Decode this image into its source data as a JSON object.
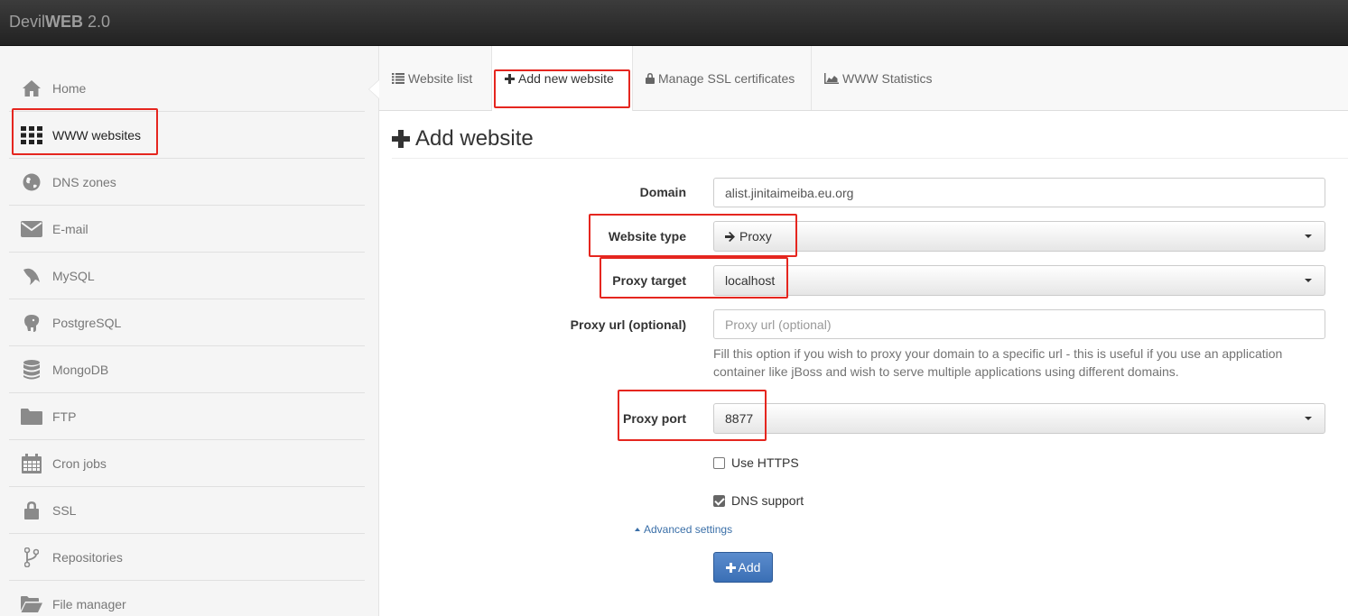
{
  "app": {
    "brand_light": "Devil",
    "brand_bold": "WEB",
    "brand_version": " 2.0"
  },
  "sidebar": {
    "items": [
      {
        "label": "Home",
        "icon": "home-icon"
      },
      {
        "label": "WWW websites",
        "icon": "grid-icon",
        "active": true
      },
      {
        "label": "DNS zones",
        "icon": "globe-icon"
      },
      {
        "label": "E-mail",
        "icon": "envelope-icon"
      },
      {
        "label": "MySQL",
        "icon": "dolphin-icon"
      },
      {
        "label": "PostgreSQL",
        "icon": "elephant-icon"
      },
      {
        "label": "MongoDB",
        "icon": "database-icon"
      },
      {
        "label": "FTP",
        "icon": "folder-icon"
      },
      {
        "label": "Cron jobs",
        "icon": "calendar-icon"
      },
      {
        "label": "SSL",
        "icon": "lock-icon"
      },
      {
        "label": "Repositories",
        "icon": "branch-icon"
      },
      {
        "label": "File manager",
        "icon": "folder-open-icon"
      }
    ]
  },
  "tabs": [
    {
      "label": "Website list",
      "icon": "list-icon"
    },
    {
      "label": "Add new website",
      "icon": "plus-icon",
      "active": true
    },
    {
      "label": "Manage SSL certificates",
      "icon": "lock-icon"
    },
    {
      "label": "WWW Statistics",
      "icon": "area-chart-icon"
    }
  ],
  "page": {
    "title": "Add website"
  },
  "form": {
    "domain": {
      "label": "Domain",
      "value": "alist.jinitaimeiba.eu.org"
    },
    "website_type": {
      "label": "Website type",
      "value": "Proxy"
    },
    "proxy_target": {
      "label": "Proxy target",
      "value": "localhost"
    },
    "proxy_url": {
      "label": "Proxy url (optional)",
      "placeholder": "Proxy url (optional)",
      "help": "Fill this option if you wish to proxy your domain to a specific url - this is useful if you use an application container like jBoss and wish to serve multiple applications using different domains."
    },
    "proxy_port": {
      "label": "Proxy port",
      "value": "8877"
    },
    "use_https": {
      "label": "Use HTTPS",
      "checked": false
    },
    "dns_support": {
      "label": "DNS support",
      "checked": true
    },
    "advanced": "Advanced settings",
    "submit": "Add"
  },
  "colors": {
    "annotation": "#e5261f",
    "primary": "#3a6fb5"
  }
}
